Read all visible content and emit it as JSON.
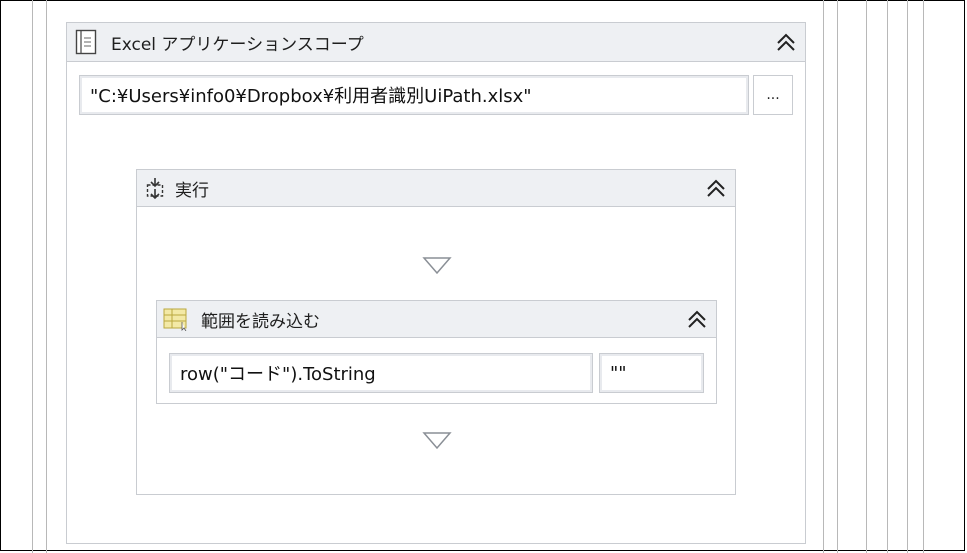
{
  "excel_scope": {
    "title": "Excel アプリケーションスコープ",
    "workbook_path": "\"C:¥Users¥info0¥Dropbox¥利用者識別UiPath.xlsx\"",
    "browse_label": "..."
  },
  "do_sequence": {
    "title": "実行"
  },
  "read_range": {
    "title": "範囲を読み込む",
    "sheet_name": "row(\"コード\").ToString",
    "range": "\"\""
  },
  "colors": {
    "header_bg": "#eef0f3",
    "border": "#c9ccd1",
    "frame_lines": "#b8b8b8"
  }
}
